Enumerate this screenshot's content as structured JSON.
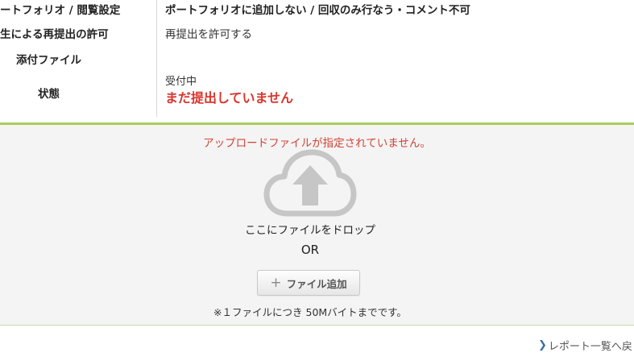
{
  "settings": {
    "rows": [
      {
        "label": "ートフォリオ / 閲覧設定",
        "value": "ポートフォリオに追加しない / 回収のみ行なう・コメント不可"
      },
      {
        "label": "生による再提出の許可",
        "value": "再提出を許可する"
      },
      {
        "label": "添付ファイル",
        "value": ""
      },
      {
        "label": "状態",
        "status_sub": "受付中",
        "status_main": "まだ提出していません"
      }
    ]
  },
  "upload": {
    "error_message": "アップロードファイルが指定されていません。",
    "icon": "cloud-upload-icon",
    "drop_text": "ここにファイルをドロップ",
    "or_text": "OR",
    "add_button_icon": "plus-icon",
    "add_button_label": "ファイル追加",
    "size_note": "※１ファイルにつき 50Mバイトまでです。"
  },
  "footer": {
    "back_link_icon": "chevron-right-icon",
    "back_link_label": "レポート一覧へ戻"
  },
  "colors": {
    "accent_green": "#a9cb5c",
    "error_red": "#d04436",
    "status_red": "#d9352d"
  }
}
